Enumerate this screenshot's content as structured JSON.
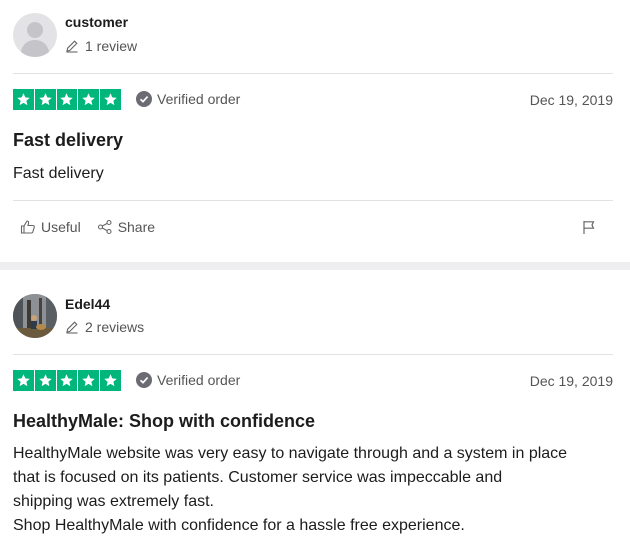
{
  "reviews": [
    {
      "user": {
        "name": "customer",
        "review_count": "1 review",
        "avatar": "generic-person-avatar"
      },
      "rating": 5,
      "verified_label": "Verified order",
      "date": "Dec 19, 2019",
      "title": "Fast delivery",
      "body": "Fast delivery",
      "actions": {
        "useful": "Useful",
        "share": "Share"
      }
    },
    {
      "user": {
        "name": "Edel44",
        "review_count": "2 reviews",
        "avatar": "photo-avatar"
      },
      "rating": 5,
      "verified_label": "Verified order",
      "date": "Dec 19, 2019",
      "title": "HealthyMale: Shop with confidence",
      "body_lines": [
        "HealthyMale website was very easy to navigate through and a system in place",
        "that is focused on its patients. Customer service was impeccable and",
        "shipping was extremely fast.",
        "Shop HealthyMale with confidence for a hassle free experience."
      ]
    }
  ],
  "colors": {
    "star_green": "#00b67a",
    "text_muted": "#555555",
    "divider": "#e1e1e6",
    "band": "#eeeef0"
  }
}
